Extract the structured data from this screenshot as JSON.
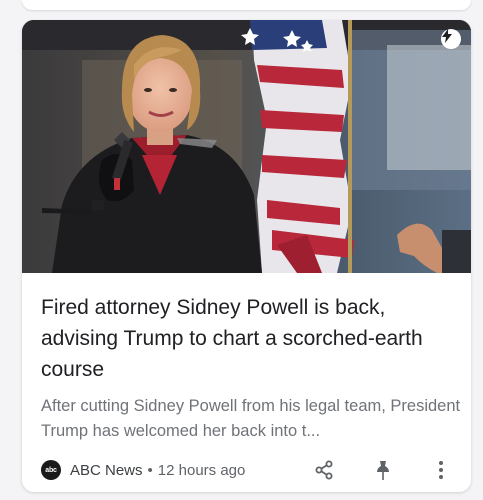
{
  "article": {
    "headline": "Fired attorney Sidney Powell is back, advising Trump to chart a scorched-earth course",
    "snippet": "After cutting Sidney Powell from his legal team, President Trump has welcomed her back into t...",
    "image_alt": "Sidney Powell speaking at a microphone in front of an American flag"
  },
  "source": {
    "logo_text": "abc",
    "name": "ABC News",
    "separator": "•",
    "age": "12 hours ago"
  },
  "icons": {
    "amp": "lightning-bolt-icon",
    "share": "share-icon",
    "pin": "pin-icon",
    "more": "more-vert-icon"
  },
  "colors": {
    "headline": "#202124",
    "snippet": "#6f7378",
    "icon": "#5f6368"
  }
}
